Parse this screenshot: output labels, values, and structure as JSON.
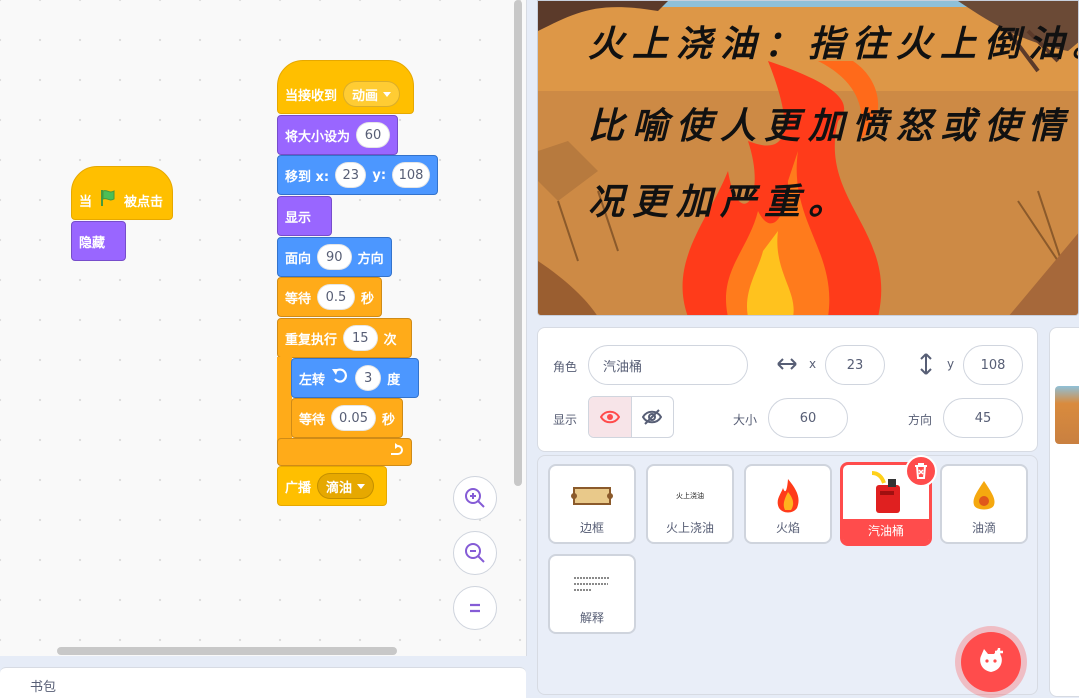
{
  "code_area": {
    "script1": {
      "hat_when": "当",
      "hat_clicked": "被点击",
      "hide": "隐藏"
    },
    "script2": {
      "receive_label": "当接收到",
      "receive_message": "动画",
      "set_size_label": "将大小设为",
      "set_size_value": "60",
      "goto_label": "移到 x:",
      "goto_x": "23",
      "goto_y_label": "y:",
      "goto_y": "108",
      "show": "显示",
      "point_label": "面向",
      "point_value": "90",
      "point_suffix": "方向",
      "wait1_label": "等待",
      "wait1_value": "0.5",
      "wait1_suffix": "秒",
      "repeat_label": "重复执行",
      "repeat_value": "15",
      "repeat_suffix": "次",
      "turn_label": "左转",
      "turn_value": "3",
      "turn_suffix": "度",
      "wait2_label": "等待",
      "wait2_value": "0.05",
      "wait2_suffix": "秒",
      "broadcast_label": "广播",
      "broadcast_message": "滴油"
    },
    "bottom_panel_label": "书包"
  },
  "stage": {
    "line1": "火上浇油：指往火上倒油。",
    "line2": "比喻使人更加愤怒或使情",
    "line3": "况更加严重。"
  },
  "sprite_info": {
    "sprite_label": "角色",
    "sprite_name": "汽油桶",
    "x_label": "x",
    "x_value": "23",
    "y_label": "y",
    "y_value": "108",
    "show_label": "显示",
    "size_label": "大小",
    "size_value": "60",
    "direction_label": "方向",
    "direction_value": "45"
  },
  "sprites": [
    {
      "name": "边框"
    },
    {
      "name": "火上浇油",
      "thumb_text": "火上浇油"
    },
    {
      "name": "火焰"
    },
    {
      "name": "汽油桶",
      "selected": true
    },
    {
      "name": "油滴"
    },
    {
      "name": "解释"
    }
  ],
  "colors": {
    "events": "#ffbf00",
    "looks": "#9966ff",
    "motion": "#4c97ff",
    "control": "#ffab19",
    "accent": "#ff4c4c"
  }
}
